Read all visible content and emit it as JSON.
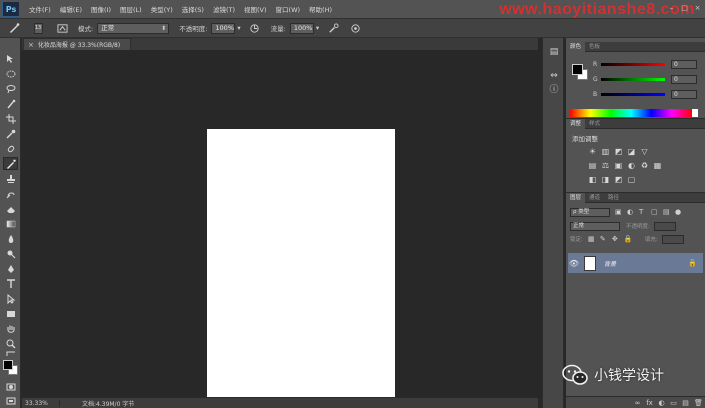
{
  "app": {
    "logo_text": "Ps",
    "watermark_url": "www.haoyitianshe8.com",
    "win_controls": [
      "–",
      "□",
      "×"
    ]
  },
  "menu": {
    "items": [
      "文件(F)",
      "编辑(E)",
      "图像(I)",
      "图层(L)",
      "类型(Y)",
      "选择(S)",
      "滤镜(T)",
      "视图(V)",
      "窗口(W)",
      "帮助(H)"
    ]
  },
  "options": {
    "brush_size": "13",
    "mode_label": "模式:",
    "mode_value": "正常",
    "opacity_label": "不透明度:",
    "opacity_value": "100%",
    "flow_label": "流量:",
    "flow_value": "100%"
  },
  "document": {
    "tab_title": "化妆品海报 @ 33.3%(RGB/8)",
    "close_glyph": "×"
  },
  "status": {
    "zoom": "33.33%",
    "doc_info": "文档:4.39M/0 字节"
  },
  "color_panel": {
    "tabs": [
      "颜色",
      "色板"
    ],
    "channels": [
      {
        "letter": "R",
        "value": "0",
        "color": "#d02020"
      },
      {
        "letter": "G",
        "value": "0",
        "color": "#20b020"
      },
      {
        "letter": "B",
        "value": "0",
        "color": "#2020d0"
      }
    ]
  },
  "adjust_panel": {
    "tabs": [
      "调整",
      "样式"
    ],
    "title": "添加调整",
    "row1": [
      "☀",
      "▥",
      "◩",
      "◪",
      "▽"
    ],
    "row2": [
      "▤",
      "⚖",
      "▣",
      "◐",
      "♻",
      "▦"
    ],
    "row3": [
      "◧",
      "◨",
      "◩",
      "▢"
    ]
  },
  "layers_panel": {
    "tabs": [
      "图层",
      "通道",
      "路径"
    ],
    "filter_label": "ρ 类型",
    "blend_mode": "正常",
    "opacity_label": "不透明度:",
    "lock_label": "锁定:",
    "fill_label": "填充:",
    "layer": {
      "name": "背景",
      "eye": "👁",
      "lock": "🔒"
    },
    "footer_icons": [
      "∞",
      "fx",
      "◐",
      "▭",
      "▤",
      "🗑"
    ]
  },
  "wechat": {
    "text": "小钱学设计"
  }
}
